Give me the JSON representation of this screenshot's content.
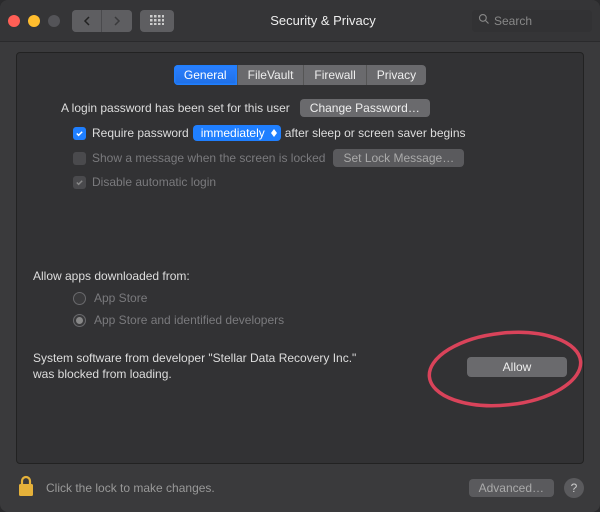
{
  "titlebar": {
    "title": "Security & Privacy",
    "search_placeholder": "Search"
  },
  "tabs": [
    {
      "label": "General",
      "active": true
    },
    {
      "label": "FileVault",
      "active": false
    },
    {
      "label": "Firewall",
      "active": false
    },
    {
      "label": "Privacy",
      "active": false
    }
  ],
  "login": {
    "password_set_text": "A login password has been set for this user",
    "change_password_btn": "Change Password…",
    "require_password_label": "Require password",
    "require_password_popup": "immediately",
    "require_password_after": "after sleep or screen saver begins",
    "show_message_label": "Show a message when the screen is locked",
    "set_lock_message_btn": "Set Lock Message…",
    "disable_auto_login_label": "Disable automatic login"
  },
  "downloads": {
    "heading": "Allow apps downloaded from:",
    "option_appstore": "App Store",
    "option_identified": "App Store and identified developers"
  },
  "blocked": {
    "text": "System software from developer \"Stellar Data Recovery Inc.\" was blocked from loading.",
    "allow_btn": "Allow"
  },
  "footer": {
    "lock_text": "Click the lock to make changes.",
    "advanced_btn": "Advanced…",
    "help": "?"
  }
}
